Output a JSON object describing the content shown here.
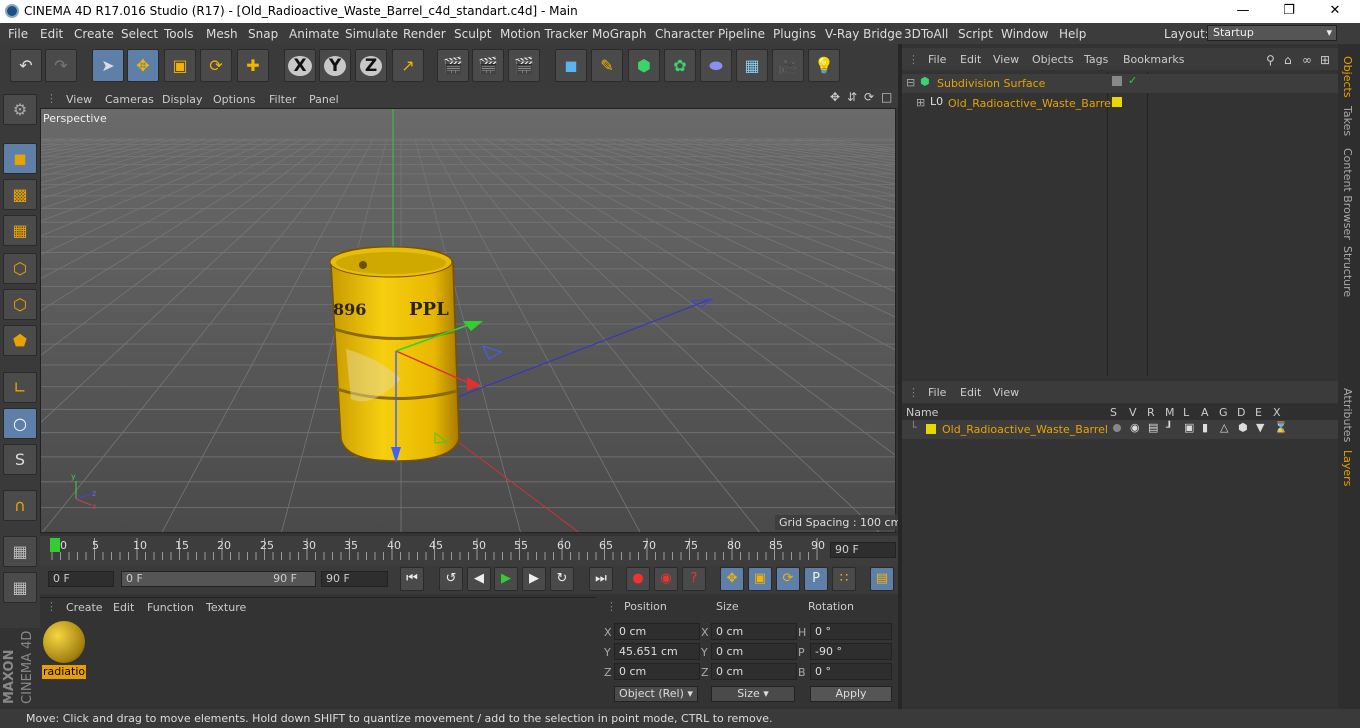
{
  "window": {
    "title": "CINEMA 4D R17.016 Studio (R17) - [Old_Radioactive_Waste_Barrel_c4d_standart.c4d] - Main"
  },
  "menu": [
    "File",
    "Edit",
    "Create",
    "Select",
    "Tools",
    "Mesh",
    "Snap",
    "Animate",
    "Simulate",
    "Render",
    "Sculpt",
    "Motion Tracker",
    "MoGraph",
    "Character",
    "Pipeline",
    "Plugins",
    "V-Ray Bridge",
    "3DToAll",
    "Script",
    "Window",
    "Help"
  ],
  "layout": {
    "label": "Layout:",
    "value": "Startup"
  },
  "viewport": {
    "menu": [
      "View",
      "Cameras",
      "Display",
      "Options",
      "Filter",
      "Panel"
    ],
    "camera": "Perspective",
    "grid_spacing": "Grid Spacing : 100 cm",
    "barrel_text1": "896",
    "barrel_text2": "PPL"
  },
  "timeline": {
    "ticks": [
      "0",
      "5",
      "10",
      "15",
      "20",
      "25",
      "30",
      "35",
      "40",
      "45",
      "50",
      "55",
      "60",
      "65",
      "70",
      "75",
      "80",
      "85",
      "90"
    ],
    "current": "90 F",
    "start_field": "0 F",
    "range_start": "0 F",
    "range_end": "90 F",
    "end_field": "90 F"
  },
  "material": {
    "menu": [
      "Create",
      "Edit",
      "Function",
      "Texture"
    ],
    "name": "radiatio"
  },
  "coords": {
    "headers": [
      "Position",
      "Size",
      "Rotation"
    ],
    "pos": {
      "x": "0 cm",
      "y": "45.651 cm",
      "z": "0 cm"
    },
    "size": {
      "x": "0 cm",
      "y": "0 cm",
      "z": "0 cm"
    },
    "rot": {
      "h": "0 °",
      "p": "-90 °",
      "b": "0 °"
    },
    "mode": "Object (Rel)",
    "size_mode": "Size",
    "apply": "Apply"
  },
  "objects": {
    "menu": [
      "File",
      "Edit",
      "View",
      "Objects",
      "Tags",
      "Bookmarks"
    ],
    "items": [
      "Subdivision Surface",
      "Old_Radioactive_Waste_Barrel"
    ]
  },
  "layers": {
    "menu": [
      "File",
      "Edit",
      "View"
    ],
    "header_name": "Name",
    "flags": [
      "S",
      "V",
      "R",
      "M",
      "L",
      "A",
      "G",
      "D",
      "E",
      "X"
    ],
    "items": [
      "Old_Radioactive_Waste_Barrel"
    ]
  },
  "side_tabs": [
    "Objects",
    "Takes",
    "Content Browser",
    "Structure",
    "Attributes",
    "Layers"
  ],
  "status": "Move: Click and drag to move elements. Hold down SHIFT to quantize movement / add to the selection in point mode, CTRL to remove.",
  "logo": {
    "line1": "MAXON",
    "line2": "CINEMA 4D"
  },
  "colors": {
    "accent": "#e8a300",
    "selected_tool": "#5e7fa8",
    "barrel": "#f2c200"
  }
}
